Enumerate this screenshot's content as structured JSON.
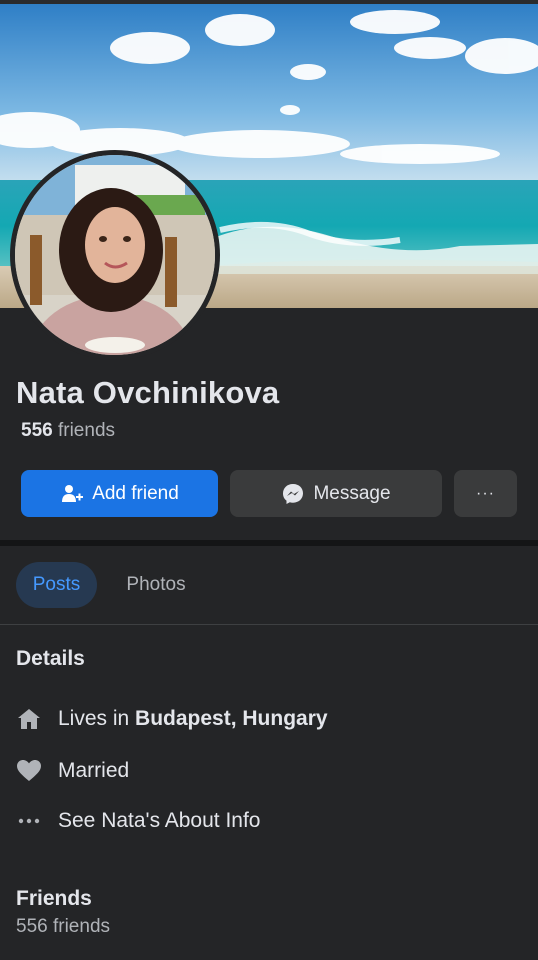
{
  "profile": {
    "name": "Nata Ovchinikova",
    "friends_count": "556",
    "friends_label": "friends"
  },
  "actions": {
    "add_friend": "Add friend",
    "message": "Message",
    "more": "···"
  },
  "tabs": [
    {
      "label": "Posts",
      "active": true
    },
    {
      "label": "Photos",
      "active": false
    }
  ],
  "details": {
    "title": "Details",
    "lives_prefix": "Lives in ",
    "lives_city": "Budapest, Hungary",
    "relationship": "Married",
    "about_link": "See Nata's About Info"
  },
  "friends_section": {
    "title": "Friends",
    "count_text": "556 friends"
  },
  "colors": {
    "background": "#242527",
    "primary_button": "#1b74e4",
    "secondary_button": "#3a3b3c",
    "active_tab_text": "#4599ff"
  },
  "icons": [
    "add-friend-icon",
    "messenger-icon",
    "more-icon",
    "home-icon",
    "heart-icon",
    "ellipsis-icon"
  ]
}
